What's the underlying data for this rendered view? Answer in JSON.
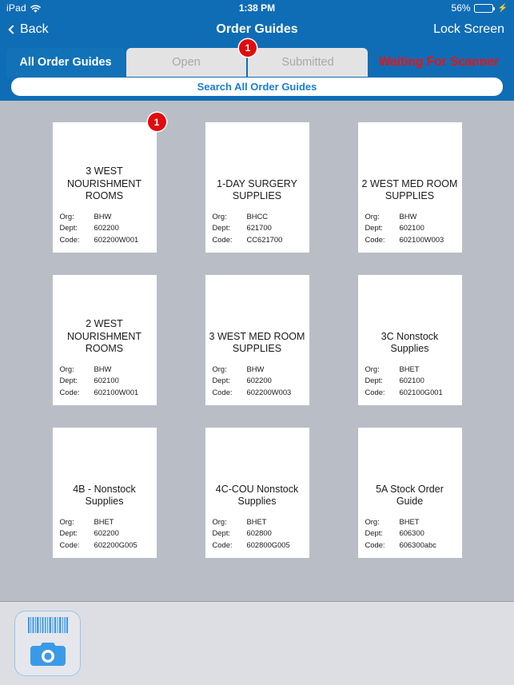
{
  "status_bar": {
    "device": "iPad",
    "wifi_icon": "wifi-icon",
    "time": "1:38 PM",
    "battery_percent": "56%",
    "battery_level": 56,
    "charging_icon": "lightning-bolt-icon"
  },
  "nav_bar": {
    "back_label": "Back",
    "back_icon": "chevron-left-icon",
    "title": "Order Guides",
    "right_action": "Lock Screen"
  },
  "tabs": [
    {
      "label": "All Order Guides",
      "state": "active",
      "badge": null
    },
    {
      "label": "Open",
      "state": "disabled",
      "badge": null
    },
    {
      "label": "Submitted",
      "state": "disabled",
      "badge": "1"
    }
  ],
  "scanner_status": {
    "text": "Waiting For Scanner",
    "color": "#ee1111"
  },
  "search": {
    "placeholder": "Search All Order Guides",
    "value": ""
  },
  "meta_labels": {
    "org": "Org:",
    "dept": "Dept:",
    "code": "Code:"
  },
  "cards": [
    {
      "title": "3 WEST NOURISHMENT ROOMS",
      "org": "BHW",
      "dept": "602200",
      "code": "602200W001",
      "badge": "1"
    },
    {
      "title": "1-DAY SURGERY SUPPLIES",
      "org": "BHCC",
      "dept": "621700",
      "code": "CC621700",
      "badge": null
    },
    {
      "title": "2 WEST MED ROOM SUPPLIES",
      "org": "BHW",
      "dept": "602100",
      "code": "602100W003",
      "badge": null
    },
    {
      "title": "2 WEST NOURISHMENT ROOMS",
      "org": "BHW",
      "dept": "602100",
      "code": "602100W001",
      "badge": null
    },
    {
      "title": "3 WEST MED ROOM SUPPLIES",
      "org": "BHW",
      "dept": "602200",
      "code": "602200W003",
      "badge": null
    },
    {
      "title": "3C Nonstock Supplies",
      "org": "BHET",
      "dept": "602100",
      "code": "602100G001",
      "badge": null
    },
    {
      "title": "4B - Nonstock Supplies",
      "org": "BHET",
      "dept": "602200",
      "code": "602200G005",
      "badge": null
    },
    {
      "title": "4C-COU Nonstock Supplies",
      "org": "BHET",
      "dept": "602800",
      "code": "602800G005",
      "badge": null
    },
    {
      "title": "5A  Stock Order Guide",
      "org": "BHET",
      "dept": "606300",
      "code": "606300abc",
      "badge": null
    }
  ],
  "toolbar": {
    "scan_button_name": "barcode-camera-scan-button",
    "barcode_icon": "barcode-icon",
    "camera_icon": "camera-icon"
  },
  "colors": {
    "brand_blue": "#0f6db5",
    "tab_active_blue": "#1172b8",
    "badge_red": "#e00c0c",
    "alert_red": "#ee1111",
    "content_gray": "#b9bec6",
    "toolbar_gray": "#dcdee4",
    "battery_green": "#4cd964",
    "link_blue": "#1a7fd4"
  }
}
